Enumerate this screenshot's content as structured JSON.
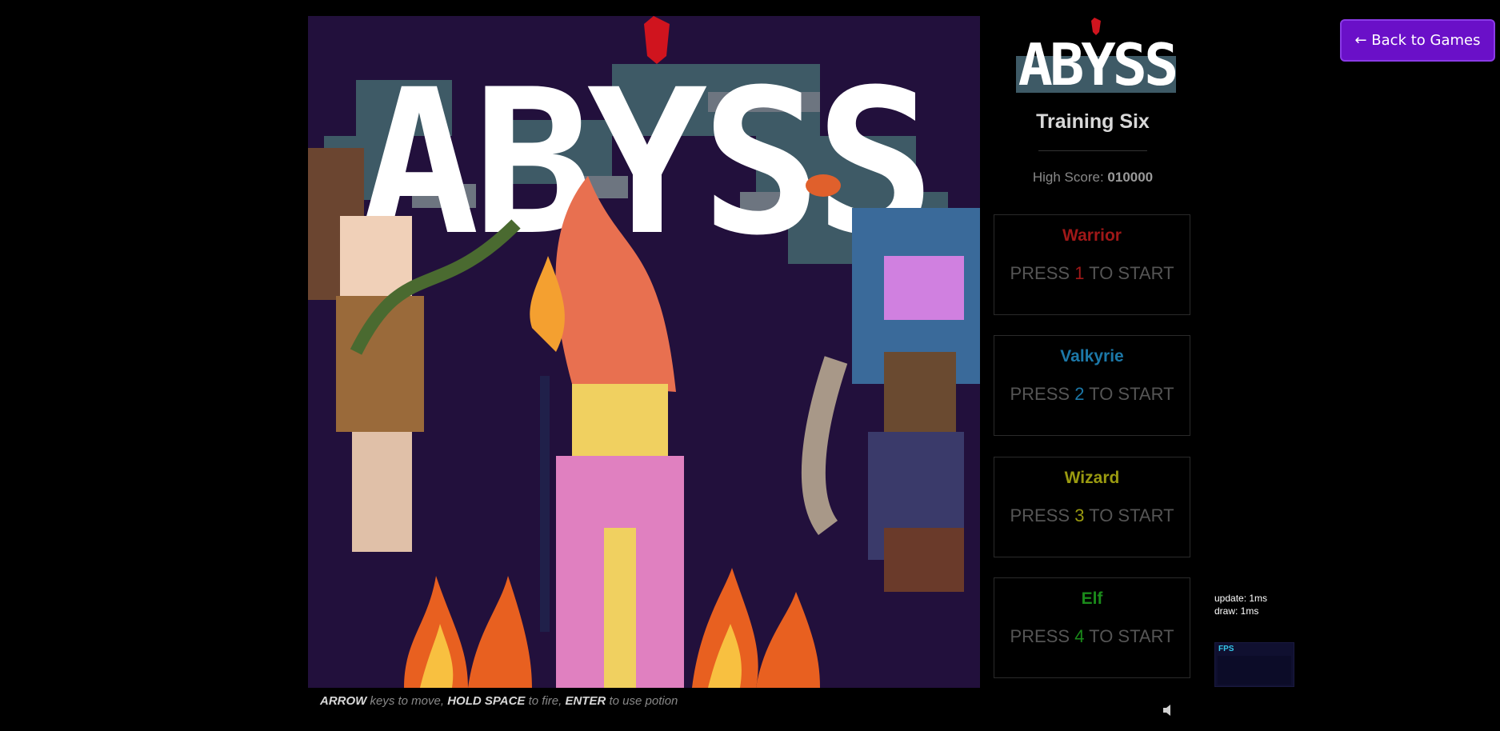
{
  "game": {
    "logo_text": "ABYSS",
    "name": "Training Six",
    "high_score_label": "High Score:",
    "high_score_value": "010000"
  },
  "players": [
    {
      "name": "Warrior",
      "color": "#a01818",
      "press": "PRESS",
      "key": "1",
      "to_start": "TO START"
    },
    {
      "name": "Valkyrie",
      "color": "#1c78a8",
      "press": "PRESS",
      "key": "2",
      "to_start": "TO START"
    },
    {
      "name": "Wizard",
      "color": "#9a9a10",
      "press": "PRESS",
      "key": "3",
      "to_start": "TO START"
    },
    {
      "name": "Elf",
      "color": "#1a8a1a",
      "press": "PRESS",
      "key": "4",
      "to_start": "TO START"
    }
  ],
  "nav": {
    "back_label": "← Back to Games"
  },
  "stats": {
    "update": "update: 1ms",
    "draw": "draw: 1ms",
    "fps_label": "FPS"
  },
  "instructions": {
    "k1": "ARROW",
    "t1": " keys to move, ",
    "k2": "HOLD SPACE",
    "t2": " to fire, ",
    "k3": "ENTER",
    "t3": " to use potion"
  },
  "icons": {
    "sound": "speaker-icon"
  }
}
